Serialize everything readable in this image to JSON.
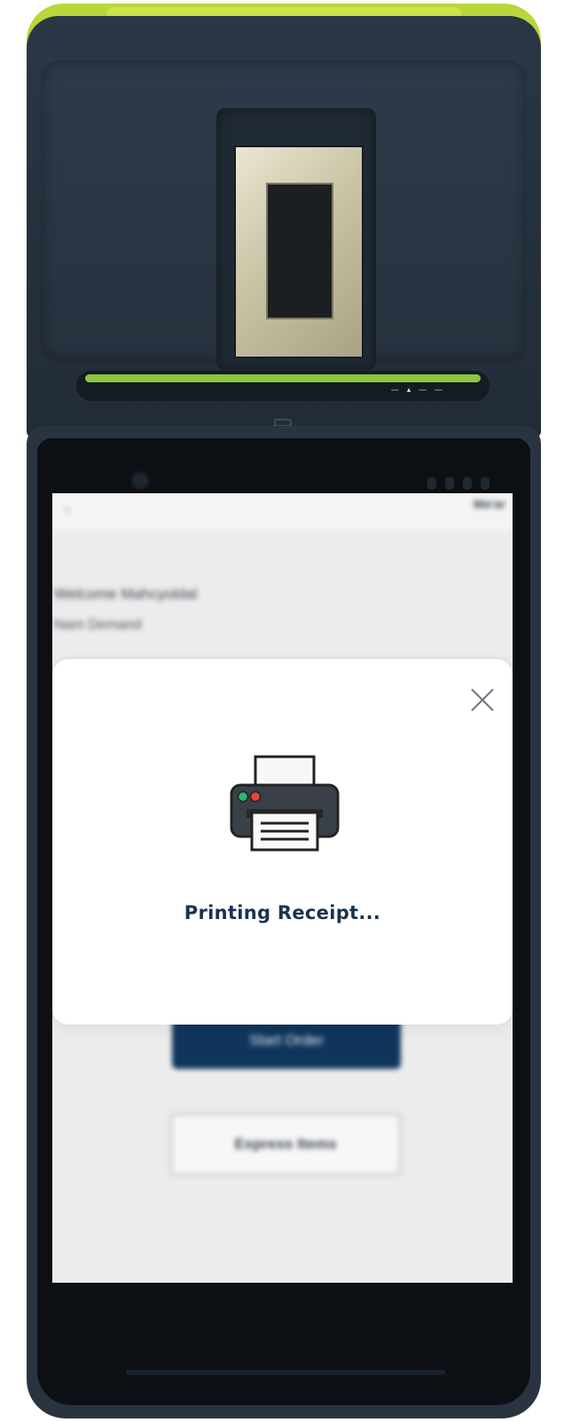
{
  "device": {
    "accent_color": "#b9d63a",
    "body_color": "#26313e",
    "printer_paper_color": "#8cc63f",
    "slot_marks": "— ▴ — —"
  },
  "app": {
    "header_right": "Ma'ar",
    "welcome_text": "Welcome Mahcyoldal",
    "sub_text": "Nam Demand",
    "start_order_label": "Start Order",
    "express_items_label": "Express Items"
  },
  "modal": {
    "icon": "printer-icon",
    "message": "Printing Receipt...",
    "close_icon": "close-icon",
    "title_color": "#1d3150"
  }
}
